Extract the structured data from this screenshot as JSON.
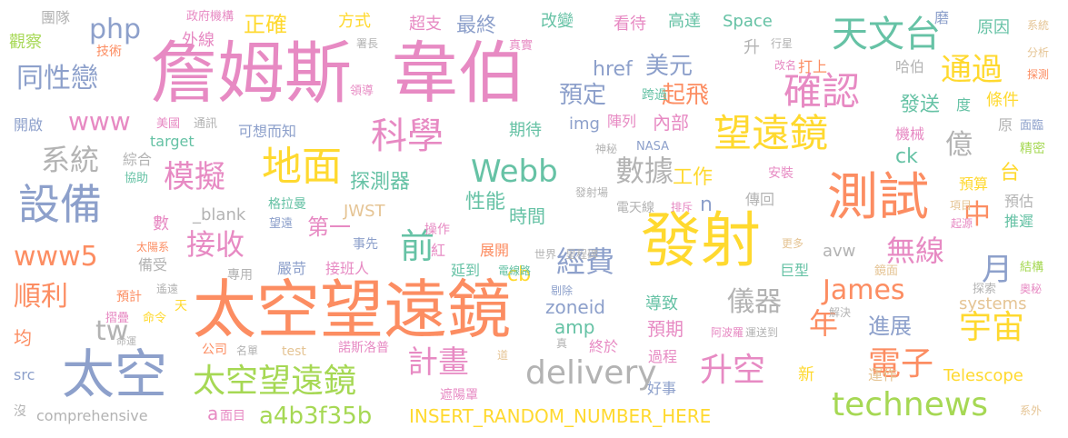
{
  "palette": {
    "pink": "#E78AC3",
    "orange": "#FC8D62",
    "blue": "#8DA0CB",
    "green": "#A6D854",
    "yellow": "#FFD92F",
    "teal": "#66C2A5",
    "tan": "#E5C494",
    "gray": "#B3B3B3"
  },
  "words": [
    {
      "text": "詹姆斯",
      "color": "pink",
      "size": 74
    },
    {
      "text": "韋伯",
      "color": "pink",
      "size": 74
    },
    {
      "text": "太空望遠鏡",
      "color": "orange",
      "size": 70
    },
    {
      "text": "發射",
      "color": "yellow",
      "size": 66
    },
    {
      "text": "太空",
      "color": "blue",
      "size": 58
    },
    {
      "text": "測試",
      "color": "orange",
      "size": 56
    },
    {
      "text": "設備",
      "color": "blue",
      "size": 46
    },
    {
      "text": "地面",
      "color": "yellow",
      "size": 44
    },
    {
      "text": "天文台",
      "color": "teal",
      "size": 40
    },
    {
      "text": "確認",
      "color": "pink",
      "size": 42
    },
    {
      "text": "望遠鏡",
      "color": "yellow",
      "size": 42
    },
    {
      "text": "科學",
      "color": "pink",
      "size": 40
    },
    {
      "text": "delivery",
      "color": "gray",
      "size": 36
    },
    {
      "text": "technews",
      "color": "green",
      "size": 36
    },
    {
      "text": "太空望遠鏡",
      "color": "green",
      "size": 36
    },
    {
      "text": "升空",
      "color": "pink",
      "size": 36
    },
    {
      "text": "電子",
      "color": "orange",
      "size": 36
    },
    {
      "text": "宇宙",
      "color": "yellow",
      "size": 36
    },
    {
      "text": "計畫",
      "color": "pink",
      "size": 34
    },
    {
      "text": "經費",
      "color": "blue",
      "size": 32
    },
    {
      "text": "前",
      "color": "teal",
      "size": 38
    },
    {
      "text": "接收",
      "color": "pink",
      "size": 32
    },
    {
      "text": "模擬",
      "color": "pink",
      "size": 34
    },
    {
      "text": "Webb",
      "color": "teal",
      "size": 34
    },
    {
      "text": "數據",
      "color": "gray",
      "size": 32
    },
    {
      "text": "系統",
      "color": "gray",
      "size": 32
    },
    {
      "text": "順利",
      "color": "orange",
      "size": 30
    },
    {
      "text": "www5",
      "color": "orange",
      "size": 30
    },
    {
      "text": "同性戀",
      "color": "blue",
      "size": 30
    },
    {
      "text": "通過",
      "color": "yellow",
      "size": 34
    },
    {
      "text": "James",
      "color": "orange",
      "size": 30
    },
    {
      "text": "無線",
      "color": "pink",
      "size": 32
    },
    {
      "text": "月",
      "color": "blue",
      "size": 34
    },
    {
      "text": "年",
      "color": "orange",
      "size": 32
    },
    {
      "text": "儀器",
      "color": "gray",
      "size": 30
    },
    {
      "text": "億",
      "color": "gray",
      "size": 30
    },
    {
      "text": "中",
      "color": "orange",
      "size": 30
    },
    {
      "text": "php",
      "color": "blue",
      "size": 30
    },
    {
      "text": "www",
      "color": "pink",
      "size": 28
    },
    {
      "text": "tw",
      "color": "gray",
      "size": 30
    },
    {
      "text": "a4b3f35b",
      "color": "green",
      "size": 26
    },
    {
      "text": "美元",
      "color": "blue",
      "size": 26
    },
    {
      "text": "正確",
      "color": "yellow",
      "size": 24
    },
    {
      "text": "預定",
      "color": "blue",
      "size": 26
    },
    {
      "text": "起飛",
      "color": "orange",
      "size": 26
    },
    {
      "text": "探測器",
      "color": "teal",
      "size": 22
    },
    {
      "text": "性能",
      "color": "teal",
      "size": 22
    },
    {
      "text": "時間",
      "color": "teal",
      "size": 20
    },
    {
      "text": "最終",
      "color": "blue",
      "size": 22
    },
    {
      "text": "href",
      "color": "blue",
      "size": 22
    },
    {
      "text": "進展",
      "color": "blue",
      "size": 24
    },
    {
      "text": "第一",
      "color": "pink",
      "size": 24
    },
    {
      "text": "發送",
      "color": "teal",
      "size": 22
    },
    {
      "text": "工作",
      "color": "yellow",
      "size": 22
    },
    {
      "text": "預期",
      "color": "pink",
      "size": 20
    },
    {
      "text": "Telescope",
      "color": "yellow",
      "size": 18
    },
    {
      "text": "amp",
      "color": "teal",
      "size": 20
    },
    {
      "text": "zoneid",
      "color": "blue",
      "size": 20
    },
    {
      "text": "ck",
      "color": "teal",
      "size": 22
    },
    {
      "text": "cb",
      "color": "yellow",
      "size": 22
    },
    {
      "text": "n",
      "color": "blue",
      "size": 22
    },
    {
      "text": "台",
      "color": "yellow",
      "size": 22
    },
    {
      "text": "INSERT_RANDOM_NUMBER_HERE",
      "color": "yellow",
      "size": 20
    },
    {
      "text": "comprehensive",
      "color": "gray",
      "size": 16
    },
    {
      "text": "systems",
      "color": "tan",
      "size": 18
    },
    {
      "text": "JWST",
      "color": "tan",
      "size": 18
    },
    {
      "text": "_blank",
      "color": "gray",
      "size": 18
    },
    {
      "text": "target",
      "color": "teal",
      "size": 16
    },
    {
      "text": "img",
      "color": "blue",
      "size": 18
    },
    {
      "text": "Space",
      "color": "teal",
      "size": 18
    },
    {
      "text": "avw",
      "color": "gray",
      "size": 18
    },
    {
      "text": "src",
      "color": "blue",
      "size": 16
    },
    {
      "text": "test",
      "color": "tan",
      "size": 14
    },
    {
      "text": "NASA",
      "color": "blue",
      "size": 13
    },
    {
      "text": "a",
      "color": "pink",
      "size": 20
    },
    {
      "text": "面目",
      "color": "pink",
      "size": 14
    },
    {
      "text": "內部",
      "color": "pink",
      "size": 20
    },
    {
      "text": "陣列",
      "color": "pink",
      "size": 16
    },
    {
      "text": "跨過",
      "color": "teal",
      "size": 14
    },
    {
      "text": "方式",
      "color": "yellow",
      "size": 18
    },
    {
      "text": "超支",
      "color": "pink",
      "size": 18
    },
    {
      "text": "改變",
      "color": "teal",
      "size": 18
    },
    {
      "text": "看待",
      "color": "pink",
      "size": 18
    },
    {
      "text": "高達",
      "color": "teal",
      "size": 18
    },
    {
      "text": "外線",
      "color": "pink",
      "size": 18
    },
    {
      "text": "期待",
      "color": "teal",
      "size": 18
    },
    {
      "text": "可想而知",
      "color": "blue",
      "size": 16
    },
    {
      "text": "觀察",
      "color": "green",
      "size": 18
    },
    {
      "text": "團隊",
      "color": "gray",
      "size": 16
    },
    {
      "text": "技術",
      "color": "orange",
      "size": 14
    },
    {
      "text": "政府機構",
      "color": "pink",
      "size": 13
    },
    {
      "text": "署長",
      "color": "gray",
      "size": 12
    },
    {
      "text": "真實",
      "color": "pink",
      "size": 13
    },
    {
      "text": "磨",
      "color": "blue",
      "size": 16
    },
    {
      "text": "原因",
      "color": "teal",
      "size": 18
    },
    {
      "text": "系統",
      "color": "tan",
      "size": 12
    },
    {
      "text": "分析",
      "color": "tan",
      "size": 12
    },
    {
      "text": "探測",
      "color": "orange",
      "size": 12
    },
    {
      "text": "升",
      "color": "gray",
      "size": 18
    },
    {
      "text": "行星",
      "color": "gray",
      "size": 12
    },
    {
      "text": "改名",
      "color": "pink",
      "size": 12
    },
    {
      "text": "打上",
      "color": "orange",
      "size": 16
    },
    {
      "text": "哈伯",
      "color": "gray",
      "size": 16
    },
    {
      "text": "領導",
      "color": "pink",
      "size": 13
    },
    {
      "text": "開啟",
      "color": "blue",
      "size": 16
    },
    {
      "text": "美國",
      "color": "pink",
      "size": 13
    },
    {
      "text": "通訊",
      "color": "gray",
      "size": 13
    },
    {
      "text": "度",
      "color": "teal",
      "size": 16
    },
    {
      "text": "條件",
      "color": "yellow",
      "size": 18
    },
    {
      "text": "原",
      "color": "gray",
      "size": 16
    },
    {
      "text": "面臨",
      "color": "blue",
      "size": 13
    },
    {
      "text": "機械",
      "color": "pink",
      "size": 16
    },
    {
      "text": "精密",
      "color": "green",
      "size": 14
    },
    {
      "text": "綜合",
      "color": "gray",
      "size": 16
    },
    {
      "text": "協助",
      "color": "teal",
      "size": 13
    },
    {
      "text": "神秘",
      "color": "gray",
      "size": 12
    },
    {
      "text": "安裝",
      "color": "pink",
      "size": 14
    },
    {
      "text": "發射場",
      "color": "gray",
      "size": 12
    },
    {
      "text": "電天線",
      "color": "gray",
      "size": 14
    },
    {
      "text": "排斥",
      "color": "pink",
      "size": 12
    },
    {
      "text": "傳回",
      "color": "gray",
      "size": 16
    },
    {
      "text": "預算",
      "color": "yellow",
      "size": 16
    },
    {
      "text": "項目",
      "color": "tan",
      "size": 12
    },
    {
      "text": "預估",
      "color": "gray",
      "size": 16
    },
    {
      "text": "格拉曼",
      "color": "teal",
      "size": 14
    },
    {
      "text": "望遠",
      "color": "blue",
      "size": 13
    },
    {
      "text": "操作",
      "color": "pink",
      "size": 14
    },
    {
      "text": "展開",
      "color": "orange",
      "size": 16
    },
    {
      "text": "起源",
      "color": "pink",
      "size": 12
    },
    {
      "text": "推遲",
      "color": "teal",
      "size": 16
    },
    {
      "text": "數",
      "color": "pink",
      "size": 18
    },
    {
      "text": "太陽系",
      "color": "orange",
      "size": 12
    },
    {
      "text": "備受",
      "color": "gray",
      "size": 16
    },
    {
      "text": "事先",
      "color": "blue",
      "size": 14
    },
    {
      "text": "紅",
      "color": "pink",
      "size": 16
    },
    {
      "text": "世界",
      "color": "gray",
      "size": 12
    },
    {
      "text": "里程碑",
      "color": "gray",
      "size": 12
    },
    {
      "text": "更多",
      "color": "tan",
      "size": 12
    },
    {
      "text": "嚴苛",
      "color": "blue",
      "size": 16
    },
    {
      "text": "接班人",
      "color": "pink",
      "size": 16
    },
    {
      "text": "延到",
      "color": "teal",
      "size": 16
    },
    {
      "text": "電線路",
      "color": "teal",
      "size": 12
    },
    {
      "text": "巨型",
      "color": "teal",
      "size": 16
    },
    {
      "text": "鏡面",
      "color": "tan",
      "size": 13
    },
    {
      "text": "結構",
      "color": "green",
      "size": 13
    },
    {
      "text": "專用",
      "color": "gray",
      "size": 14
    },
    {
      "text": "預計",
      "color": "orange",
      "size": 14
    },
    {
      "text": "遙遠",
      "color": "gray",
      "size": 12
    },
    {
      "text": "剔除",
      "color": "blue",
      "size": 12
    },
    {
      "text": "導致",
      "color": "teal",
      "size": 18
    },
    {
      "text": "探索",
      "color": "gray",
      "size": 13
    },
    {
      "text": "奧秘",
      "color": "pink",
      "size": 12
    },
    {
      "text": "摺疊",
      "color": "pink",
      "size": 13
    },
    {
      "text": "命令",
      "color": "yellow",
      "size": 13
    },
    {
      "text": "天",
      "color": "yellow",
      "size": 14
    },
    {
      "text": "解決",
      "color": "gray",
      "size": 12
    },
    {
      "text": "均",
      "color": "orange",
      "size": 20
    },
    {
      "text": "命運",
      "color": "gray",
      "size": 11
    },
    {
      "text": "阿波羅",
      "color": "pink",
      "size": 12
    },
    {
      "text": "運送到",
      "color": "gray",
      "size": 12
    },
    {
      "text": "公司",
      "color": "orange",
      "size": 14
    },
    {
      "text": "名單",
      "color": "gray",
      "size": 12
    },
    {
      "text": "諾斯洛普",
      "color": "pink",
      "size": 14
    },
    {
      "text": "道",
      "color": "tan",
      "size": 12
    },
    {
      "text": "真",
      "color": "gray",
      "size": 12
    },
    {
      "text": "終於",
      "color": "pink",
      "size": 16
    },
    {
      "text": "過程",
      "color": "pink",
      "size": 16
    },
    {
      "text": "新",
      "color": "yellow",
      "size": 18
    },
    {
      "text": "運作",
      "color": "tan",
      "size": 16
    },
    {
      "text": "好事",
      "color": "blue",
      "size": 16
    },
    {
      "text": "遮陽罩",
      "color": "pink",
      "size": 14
    },
    {
      "text": "沒",
      "color": "gray",
      "size": 14
    },
    {
      "text": "系外",
      "color": "tan",
      "size": 12
    }
  ]
}
